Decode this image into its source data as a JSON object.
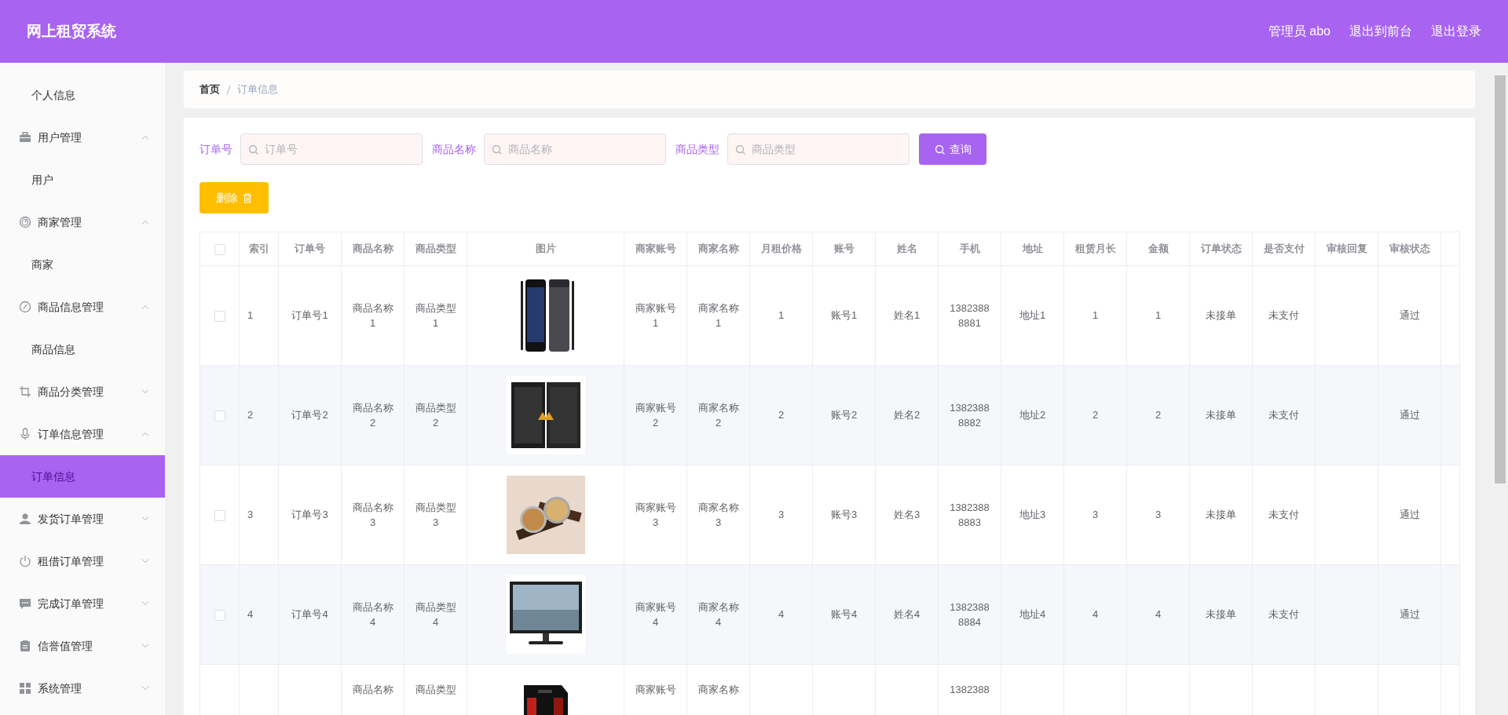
{
  "header": {
    "title": "网上租贸系统",
    "links": [
      "管理员 abo",
      "退出到前台",
      "退出登录"
    ]
  },
  "sidebar": {
    "items": [
      {
        "label": "个人信息",
        "selected": false
      },
      {
        "label": "用户管理",
        "expanded": true,
        "children": [
          {
            "label": "用户",
            "selected": false
          }
        ]
      },
      {
        "label": "商家管理",
        "expanded": true,
        "children": [
          {
            "label": "商家",
            "selected": false
          }
        ]
      },
      {
        "label": "商品信息管理",
        "expanded": true,
        "children": [
          {
            "label": "商品信息",
            "selected": false
          }
        ]
      },
      {
        "label": "商品分类管理",
        "expanded": false
      },
      {
        "label": "订单信息管理",
        "expanded": true,
        "children": [
          {
            "label": "订单信息",
            "selected": true
          }
        ]
      },
      {
        "label": "发货订单管理",
        "expanded": false
      },
      {
        "label": "租借订单管理",
        "expanded": false
      },
      {
        "label": "完成订单管理",
        "expanded": false
      },
      {
        "label": "信誉值管理",
        "expanded": false
      },
      {
        "label": "系统管理",
        "expanded": false
      }
    ]
  },
  "breadcrumb": [
    "首页",
    "订单信息"
  ],
  "filters": [
    {
      "label": "订单号",
      "placeholder": "订单号"
    },
    {
      "label": "商品名称",
      "placeholder": "商品名称"
    },
    {
      "label": "商品类型",
      "placeholder": "商品类型"
    }
  ],
  "search_button": "查询",
  "delete_button": "删除",
  "table": {
    "header_checked": false,
    "columns": [
      "索引",
      "订单号",
      "商品名称",
      "商品类型",
      "图片",
      "商家账号",
      "商家名称",
      "月租价格",
      "账号",
      "姓名",
      "手机",
      "地址",
      "租赁月长",
      "金额",
      "订单状态",
      "是否支付",
      "审核回复",
      "审核状态"
    ],
    "rows": [
      {
        "checked": false,
        "cells": [
          "1",
          "订单号1",
          "商品名称1",
          "商品类型1",
          {
            "kind": "picture"
          },
          "商家账号1",
          "商家名称1",
          "1",
          "账号1",
          "姓名1",
          "13823888881",
          "地址1",
          "1",
          "1",
          "未接单",
          "未支付",
          null,
          "通过"
        ]
      },
      {
        "checked": false,
        "cells": [
          "2",
          "订单号2",
          "商品名称2",
          "商品类型2",
          {
            "kind": "picture"
          },
          "商家账号2",
          "商家名称2",
          "2",
          "账号2",
          "姓名2",
          "13823888882",
          "地址2",
          "2",
          "2",
          "未接单",
          "未支付",
          null,
          "通过"
        ]
      },
      {
        "checked": false,
        "cells": [
          "3",
          "订单号3",
          "商品名称3",
          "商品类型3",
          {
            "kind": "picture"
          },
          "商家账号3",
          "商家名称3",
          "3",
          "账号3",
          "姓名3",
          "13823888883",
          "地址3",
          "3",
          "3",
          "未接单",
          "未支付",
          null,
          "通过"
        ]
      },
      {
        "checked": false,
        "cells": [
          "4",
          "订单号4",
          "商品名称4",
          "商品类型4",
          {
            "kind": "picture"
          },
          "商家账号4",
          "商家名称4",
          "4",
          "账号4",
          "姓名4",
          "13823888884",
          "地址4",
          "4",
          "4",
          "未接单",
          "未支付",
          null,
          "通过"
        ]
      },
      {
        "cut": true,
        "cells": [
          null,
          null,
          "商品名称",
          "商品类型",
          {
            "kind": "picture"
          },
          "商家账号",
          "商家名称",
          null,
          null,
          null,
          "1382388",
          null,
          null,
          null,
          null,
          null,
          null,
          null
        ]
      }
    ]
  }
}
